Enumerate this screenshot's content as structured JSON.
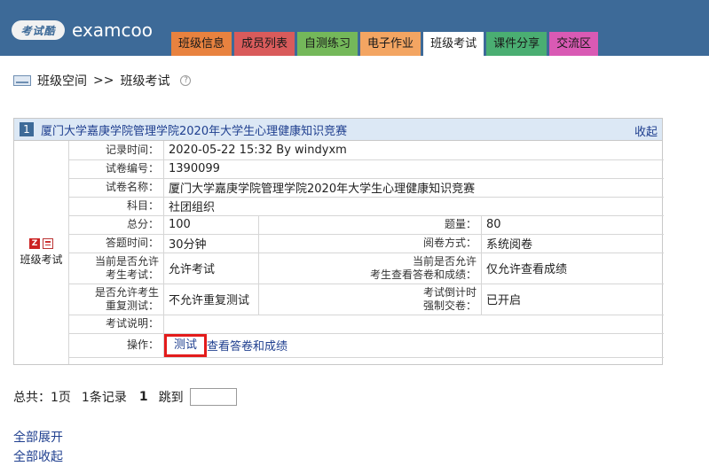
{
  "header": {
    "logo_badge": "考试酷",
    "logo_text": "examcoo",
    "tabs": [
      {
        "label": "班级信息",
        "color": "#e8823f"
      },
      {
        "label": "成员列表",
        "color": "#d95b5b"
      },
      {
        "label": "自测练习",
        "color": "#74b85a"
      },
      {
        "label": "电子作业",
        "color": "#f3a562"
      },
      {
        "label": "班级考试",
        "color": "#ffffff",
        "active": true
      },
      {
        "label": "课件分享",
        "color": "#4aae72"
      },
      {
        "label": "交流区",
        "color": "#d95ab4"
      }
    ]
  },
  "breadcrumb": {
    "root": "班级空间",
    "sep": ">>",
    "current": "班级考试",
    "help": "?"
  },
  "exam": {
    "index": "1",
    "title": "厦门大学嘉庚学院管理学院2020年大学生心理健康知识竞赛",
    "collapse": "收起",
    "side_label": "班级考试",
    "side_icon_letter": "Z",
    "record_time_label": "记录时间：",
    "record_time": "2020-05-22 15:32  By windyxm",
    "paper_no_label": "试卷编号：",
    "paper_no": "1390099",
    "paper_name_label": "试卷名称：",
    "paper_name": "厦门大学嘉庚学院管理学院2020年大学生心理健康知识竞赛",
    "subject_label": "科目：",
    "subject": "社团组织",
    "total_label": "总分：",
    "total": "100",
    "count_label": "题量：",
    "count": "80",
    "duration_label": "答题时间：",
    "duration": "30分钟",
    "grading_label": "阅卷方式：",
    "grading": "系统阅卷",
    "allow_test_label_1": "当前是否允许",
    "allow_test_label_2": "考生考试：",
    "allow_test": "允许考试",
    "allow_view_label_1": "当前是否允许",
    "allow_view_label_2": "考生查看答卷和成绩：",
    "allow_view": "仅允许查看成绩",
    "retest_label_1": "是否允许考生",
    "retest_label_2": "重复测试：",
    "retest": "不允许重复测试",
    "countdown_label_1": "考试倒计时",
    "countdown_label_2": "强制交卷：",
    "countdown": "已开启",
    "desc_label": "考试说明：",
    "desc": "",
    "ops_label": "操作：",
    "op_test": "测试",
    "op_view": "查看答卷和成绩"
  },
  "pager": {
    "total": "总共：1页",
    "records": "1条记录",
    "current": "1",
    "jump": "跳到",
    "jump_value": ""
  },
  "links": {
    "expand_all": "全部展开",
    "collapse_all": "全部收起"
  }
}
